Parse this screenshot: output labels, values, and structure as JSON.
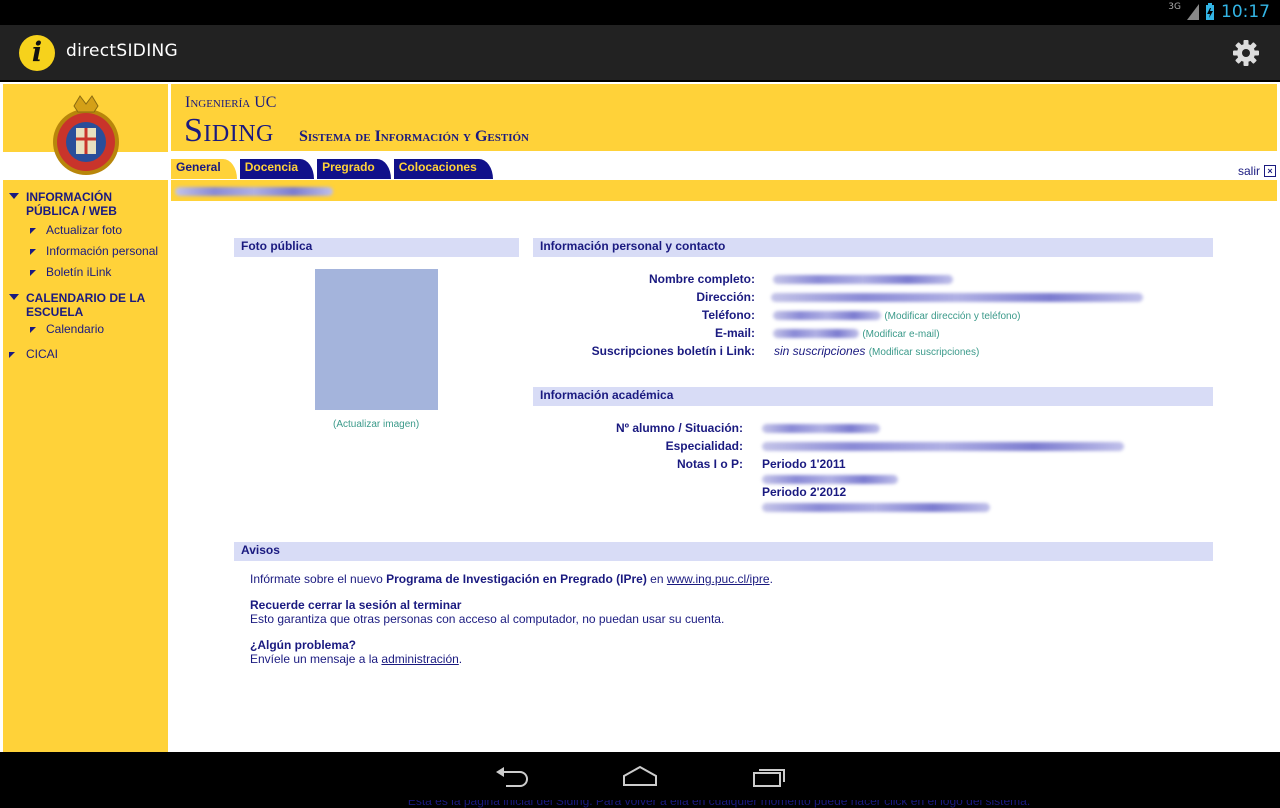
{
  "status": {
    "network": "3G",
    "time": "10:17"
  },
  "app": {
    "title": "directSIDING",
    "logo_letter": "i"
  },
  "header": {
    "org": "Ingeniería UC",
    "system": "Siding",
    "subtitle": "Sistema de Información y Gestión"
  },
  "tabs": [
    {
      "label": "General",
      "active": true
    },
    {
      "label": "Docencia",
      "active": false
    },
    {
      "label": "Pregrado",
      "active": false
    },
    {
      "label": "Colocaciones",
      "active": false
    }
  ],
  "logout_label": "salir",
  "sidebar": {
    "sections": [
      {
        "label": "INFORMACIÓN PÚBLICA / WEB",
        "items": [
          "Actualizar foto",
          "Información personal",
          "Boletín iLink"
        ]
      },
      {
        "label": "CALENDARIO DE LA ESCUELA",
        "items": [
          "Calendario"
        ]
      }
    ],
    "extra_item": "CICAI"
  },
  "photo_section": {
    "title": "Foto pública",
    "update_link": "(Actualizar imagen)"
  },
  "personal": {
    "title": "Información personal y contacto",
    "fields": [
      {
        "label": "Nombre completo:"
      },
      {
        "label": "Dirección:"
      },
      {
        "label": "Teléfono:",
        "link": "(Modificar dirección y teléfono)"
      },
      {
        "label": "E-mail:",
        "link": "(Modificar e-mail)"
      },
      {
        "label": "Suscripciones boletín i Link:",
        "value": "sin suscripciones",
        "link": "(Modificar suscripciones)"
      }
    ]
  },
  "academic": {
    "title": "Información académica",
    "fields": [
      {
        "label": "Nº alumno / Situación:"
      },
      {
        "label": "Especialidad:"
      },
      {
        "label": "Notas I o P:"
      }
    ],
    "periods": [
      "Periodo 1'2011",
      "Periodo 2'2012"
    ]
  },
  "avisos": {
    "title": "Avisos",
    "line1_pre": "Infórmate sobre el nuevo ",
    "line1_bold": "Programa de Investigación en Pregrado (IPre)",
    "line1_mid": " en ",
    "line1_link": "www.ing.puc.cl/ipre",
    "line1_end": ".",
    "session_title": "Recuerde cerrar la sesión al terminar",
    "session_text": "Esto garantiza que otras personas con acceso al computador, no puedan usar su cuenta.",
    "problem_title": "¿Algún problema?",
    "problem_pre": "Envíele un mensaje a la ",
    "problem_link": "administración",
    "problem_end": "."
  },
  "footer_note": "Esta es la pagina inicial del Siding. Para volver a ella en cualquier momento puede hacer click en el logo del sistema.",
  "colors": {
    "yellow": "#ffd239",
    "navy": "#1a1a80",
    "tab_blue": "#10108a",
    "bar_blue": "#d8dcf6",
    "link_green": "#3b9a8a"
  }
}
